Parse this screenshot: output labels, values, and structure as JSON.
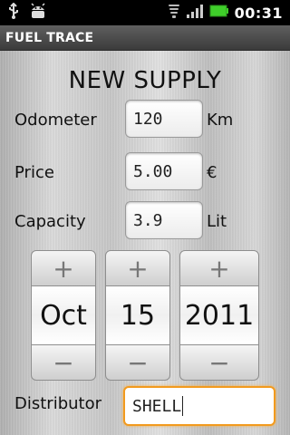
{
  "status_bar": {
    "time": "00:31",
    "icons": [
      "usb-icon",
      "android-debug-icon",
      "wifi-icon",
      "signal-icon",
      "battery-icon"
    ]
  },
  "app": {
    "title": "FUEL TRACE"
  },
  "screen": {
    "heading": "NEW SUPPLY"
  },
  "form": {
    "odometer": {
      "label": "Odometer",
      "value": "120",
      "unit": "Km"
    },
    "price": {
      "label": "Price",
      "value": "5.00",
      "unit": "€"
    },
    "capacity": {
      "label": "Capacity",
      "value": "3.9",
      "unit": "Lit"
    },
    "date": {
      "month": "Oct",
      "day": "15",
      "year": "2011",
      "increment_symbol": "+",
      "decrement_symbol": "−"
    },
    "distributor": {
      "label": "Distributor",
      "value": "SHELL"
    }
  },
  "colors": {
    "focus_border": "#f29a1e",
    "titlebar": "#4a4a4a",
    "statusbar": "#000000"
  }
}
